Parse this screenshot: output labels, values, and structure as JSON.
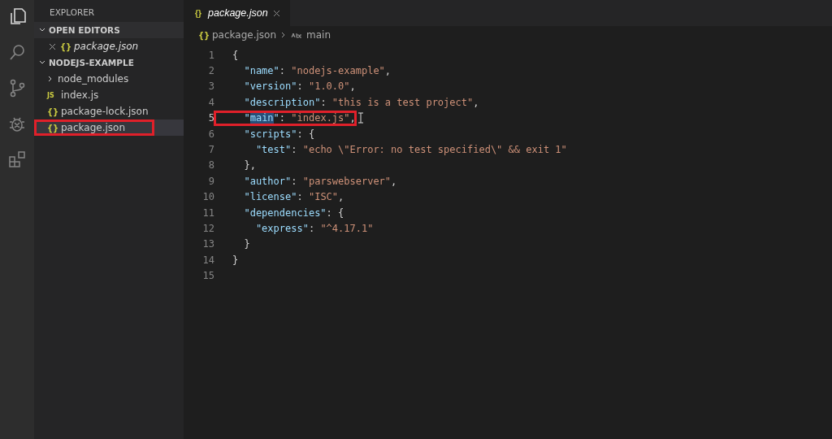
{
  "activity_bar": {
    "items": [
      {
        "kind": "files",
        "selected": true
      },
      {
        "kind": "search",
        "selected": false
      },
      {
        "kind": "source-control",
        "selected": false
      },
      {
        "kind": "debug",
        "selected": false
      },
      {
        "kind": "extensions",
        "selected": false
      }
    ]
  },
  "sidebar": {
    "title": "EXPLORER",
    "sections": [
      {
        "title": "OPEN EDITORS",
        "expanded": true,
        "items": [
          {
            "kind": "json",
            "icon": "{}",
            "label": "package.json",
            "closable": true,
            "selected": false,
            "annotated": false
          }
        ]
      },
      {
        "title": "NODEJS-EXAMPLE",
        "expanded": true,
        "items": [
          {
            "kind": "folder",
            "label": "node_modules",
            "expanded": false,
            "selected": false,
            "annotated": false
          },
          {
            "kind": "js",
            "icon": "JS",
            "label": "index.js",
            "selected": false,
            "annotated": false
          },
          {
            "kind": "json",
            "icon": "{}",
            "label": "package-lock.json",
            "selected": false,
            "annotated": false
          },
          {
            "kind": "json",
            "icon": "{}",
            "label": "package.json",
            "selected": true,
            "annotated": true
          }
        ]
      }
    ]
  },
  "tabs": [
    {
      "icon": "{}",
      "label": "package.json",
      "selected": true
    }
  ],
  "breadcrumb": {
    "icon": "{}",
    "file": "package.json",
    "symbol": "main"
  },
  "code": [
    {
      "number": "1",
      "annotated": false,
      "tokens": [
        {
          "kind": "punct",
          "text": "{"
        }
      ]
    },
    {
      "number": "2",
      "annotated": false,
      "tokens": [
        {
          "kind": "key",
          "text": "  \"name\""
        },
        {
          "kind": "punct",
          "text": ": "
        },
        {
          "kind": "string",
          "text": "\"nodejs-example\""
        },
        {
          "kind": "punct",
          "text": ","
        }
      ]
    },
    {
      "number": "3",
      "annotated": false,
      "tokens": [
        {
          "kind": "key",
          "text": "  \"version\""
        },
        {
          "kind": "punct",
          "text": ": "
        },
        {
          "kind": "string",
          "text": "\"1.0.0\""
        },
        {
          "kind": "punct",
          "text": ","
        }
      ]
    },
    {
      "number": "4",
      "annotated": false,
      "tokens": [
        {
          "kind": "key",
          "text": "  \"description\""
        },
        {
          "kind": "punct",
          "text": ": "
        },
        {
          "kind": "string",
          "text": "\"this is a test project\""
        },
        {
          "kind": "punct",
          "text": ","
        }
      ]
    },
    {
      "number": "5",
      "annotated": true,
      "tokens": [
        {
          "kind": "key",
          "text": "  \""
        },
        {
          "kind": "selected-key",
          "text": "main"
        },
        {
          "kind": "key",
          "text": "\""
        },
        {
          "kind": "punct",
          "text": ": "
        },
        {
          "kind": "string",
          "text": "\"index.js\""
        },
        {
          "kind": "punct",
          "text": ","
        }
      ]
    },
    {
      "number": "6",
      "annotated": false,
      "tokens": [
        {
          "kind": "key",
          "text": "  \"scripts\""
        },
        {
          "kind": "punct",
          "text": ": {"
        }
      ]
    },
    {
      "number": "7",
      "annotated": false,
      "tokens": [
        {
          "kind": "key",
          "text": "    \"test\""
        },
        {
          "kind": "punct",
          "text": ": "
        },
        {
          "kind": "string",
          "text": "\"echo \\\"Error: no test specified\\\" && exit 1\""
        }
      ]
    },
    {
      "number": "8",
      "annotated": false,
      "tokens": [
        {
          "kind": "punct",
          "text": "  },"
        }
      ]
    },
    {
      "number": "9",
      "annotated": false,
      "tokens": [
        {
          "kind": "key",
          "text": "  \"author\""
        },
        {
          "kind": "punct",
          "text": ": "
        },
        {
          "kind": "string",
          "text": "\"parswebserver\""
        },
        {
          "kind": "punct",
          "text": ","
        }
      ]
    },
    {
      "number": "10",
      "annotated": false,
      "tokens": [
        {
          "kind": "key",
          "text": "  \"license\""
        },
        {
          "kind": "punct",
          "text": ": "
        },
        {
          "kind": "string",
          "text": "\"ISC\""
        },
        {
          "kind": "punct",
          "text": ","
        }
      ]
    },
    {
      "number": "11",
      "annotated": false,
      "tokens": [
        {
          "kind": "key",
          "text": "  \"dependencies\""
        },
        {
          "kind": "punct",
          "text": ": {"
        }
      ]
    },
    {
      "number": "12",
      "annotated": false,
      "tokens": [
        {
          "kind": "key",
          "text": "    \"express\""
        },
        {
          "kind": "punct",
          "text": ": "
        },
        {
          "kind": "string",
          "text": "\"^4.17.1\""
        }
      ]
    },
    {
      "number": "13",
      "annotated": false,
      "tokens": [
        {
          "kind": "punct",
          "text": "  }"
        }
      ]
    },
    {
      "number": "14",
      "annotated": false,
      "tokens": [
        {
          "kind": "punct",
          "text": "}"
        }
      ]
    },
    {
      "number": "15",
      "annotated": false
    }
  ]
}
